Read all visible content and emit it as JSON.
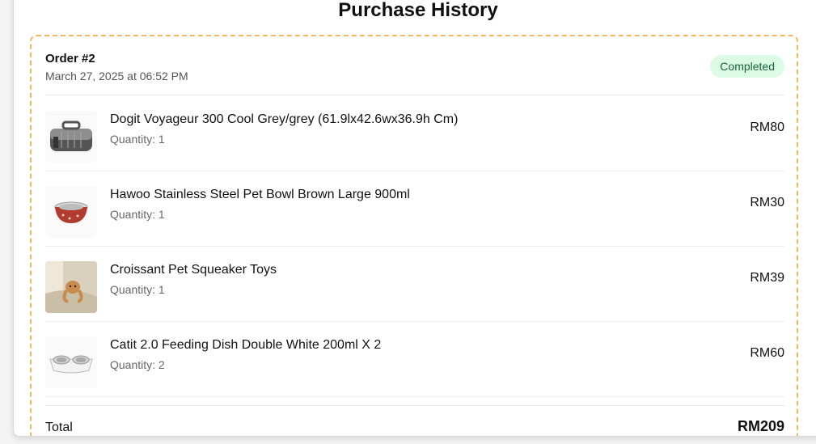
{
  "page": {
    "title": "Purchase History"
  },
  "order": {
    "id": "Order #2",
    "date": "March 27, 2025 at 06:52 PM",
    "status": "Completed",
    "status_color": "#166534",
    "status_bg": "#dcfce7",
    "accent_border": "#f6b55e",
    "items": [
      {
        "name": "Dogit Voyageur 300 Cool Grey/grey (61.9lx42.6wx36.9h Cm)",
        "quantity": "Quantity: 1",
        "price": "RM80",
        "icon": "pet-carrier-image"
      },
      {
        "name": "Hawoo Stainless Steel Pet Bowl Brown Large 900ml",
        "quantity": "Quantity: 1",
        "price": "RM30",
        "icon": "pet-bowl-image"
      },
      {
        "name": "Croissant Pet Squeaker Toys",
        "quantity": "Quantity: 1",
        "price": "RM39",
        "icon": "squeaker-toy-image"
      },
      {
        "name": "Catit 2.0 Feeding Dish Double White 200ml X 2",
        "quantity": "Quantity: 2",
        "price": "RM60",
        "icon": "feeding-dish-image"
      }
    ],
    "total_label": "Total",
    "total_value": "RM209"
  }
}
